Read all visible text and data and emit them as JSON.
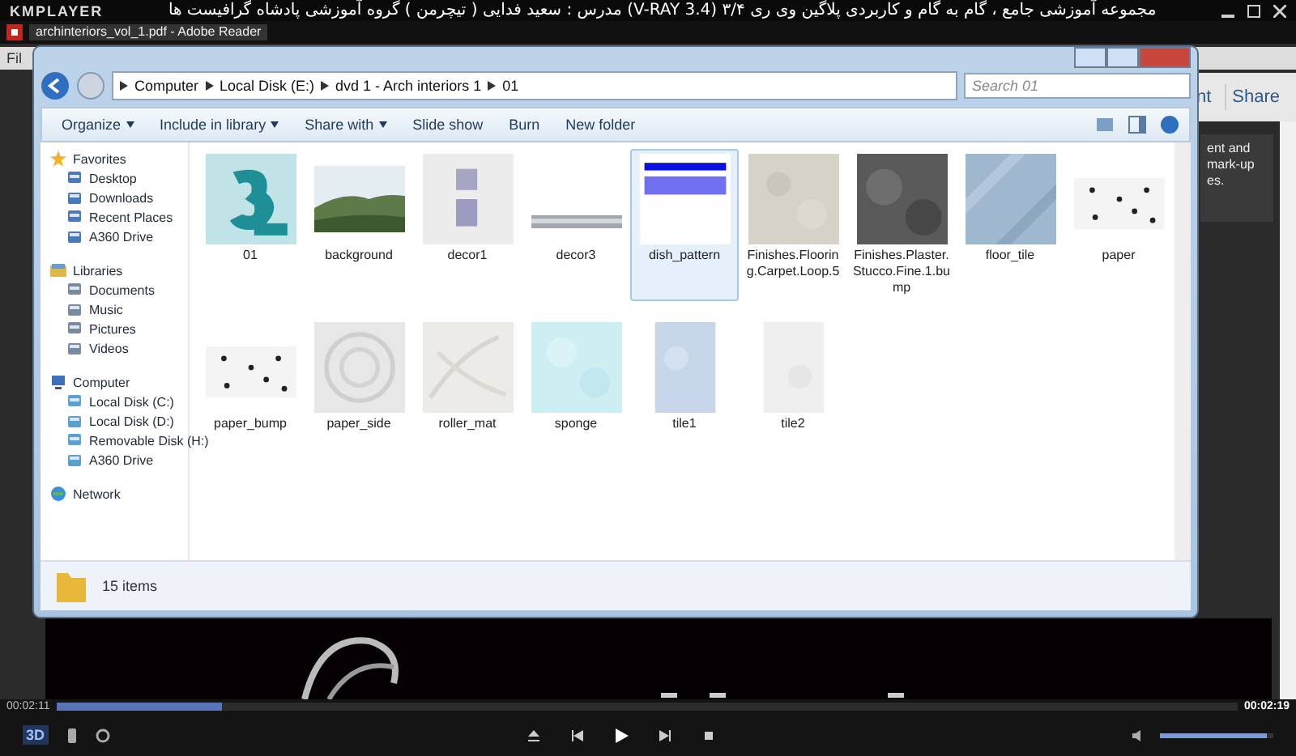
{
  "player": {
    "logo": "KMPLAYER",
    "title": "مجموعه آموزشی جامع ، گام به گام و کاربردی پلاگین وی ری ۳/۴  (V-RAY 3.4)  مدرس : سعید فدایی ( تیچرمن ) گروه آموزشی پادشاه گرافیست ها",
    "elapsed": "00:02:11",
    "total": "00:02:19",
    "mode_badge": "3D",
    "seek": {
      "level": 0.14
    },
    "volume": {
      "level": 0.95
    }
  },
  "reader": {
    "title": "archinteriors_vol_1.pdf - Adobe Reader",
    "menu": "Fil",
    "toolbar_text": "nt",
    "share": "Share",
    "panel_lines": [
      "ent and",
      "mark-up",
      "es."
    ]
  },
  "explorer": {
    "breadcrumb": [
      "Computer",
      "Local Disk (E:)",
      "dvd 1 - Arch interiors 1",
      "01"
    ],
    "search": {
      "placeholder": "Search 01"
    },
    "toolbar": [
      {
        "label": "Organize",
        "menu": true
      },
      {
        "label": "Include in library",
        "menu": true
      },
      {
        "label": "Share with",
        "menu": true
      },
      {
        "label": "Slide show",
        "menu": false
      },
      {
        "label": "Burn",
        "menu": false
      },
      {
        "label": "New folder",
        "menu": false
      }
    ],
    "sidebar": [
      {
        "label": "Favorites",
        "children": [
          {
            "label": "Desktop"
          },
          {
            "label": "Downloads"
          },
          {
            "label": "Recent Places"
          },
          {
            "label": "A360 Drive"
          }
        ]
      },
      {
        "label": "Libraries",
        "children": [
          {
            "label": "Documents"
          },
          {
            "label": "Music"
          },
          {
            "label": "Pictures"
          },
          {
            "label": "Videos"
          }
        ]
      },
      {
        "label": "Computer",
        "children": [
          {
            "label": "Local Disk (C:)"
          },
          {
            "label": "Local Disk (D:)"
          },
          {
            "label": "Removable Disk (H:)"
          },
          {
            "label": "A360 Drive"
          }
        ]
      },
      {
        "label": "Network"
      }
    ],
    "files": [
      {
        "name": "01",
        "selected": false
      },
      {
        "name": "background",
        "selected": false
      },
      {
        "name": "decor1",
        "selected": false
      },
      {
        "name": "decor3",
        "selected": false
      },
      {
        "name": "dish_pattern",
        "selected": true
      },
      {
        "name": "Finishes.Flooring.Carpet.Loop.5",
        "selected": false
      },
      {
        "name": "Finishes.Plaster.Stucco.Fine.1.bump",
        "selected": false
      },
      {
        "name": "floor_tile",
        "selected": false
      },
      {
        "name": "paper",
        "selected": false
      },
      {
        "name": "paper_bump",
        "selected": false
      },
      {
        "name": "paper_side",
        "selected": false
      },
      {
        "name": "roller_mat",
        "selected": false
      },
      {
        "name": "sponge",
        "selected": false
      },
      {
        "name": "tile1",
        "selected": false
      },
      {
        "name": "tile2",
        "selected": false
      }
    ],
    "status": "15 items"
  }
}
